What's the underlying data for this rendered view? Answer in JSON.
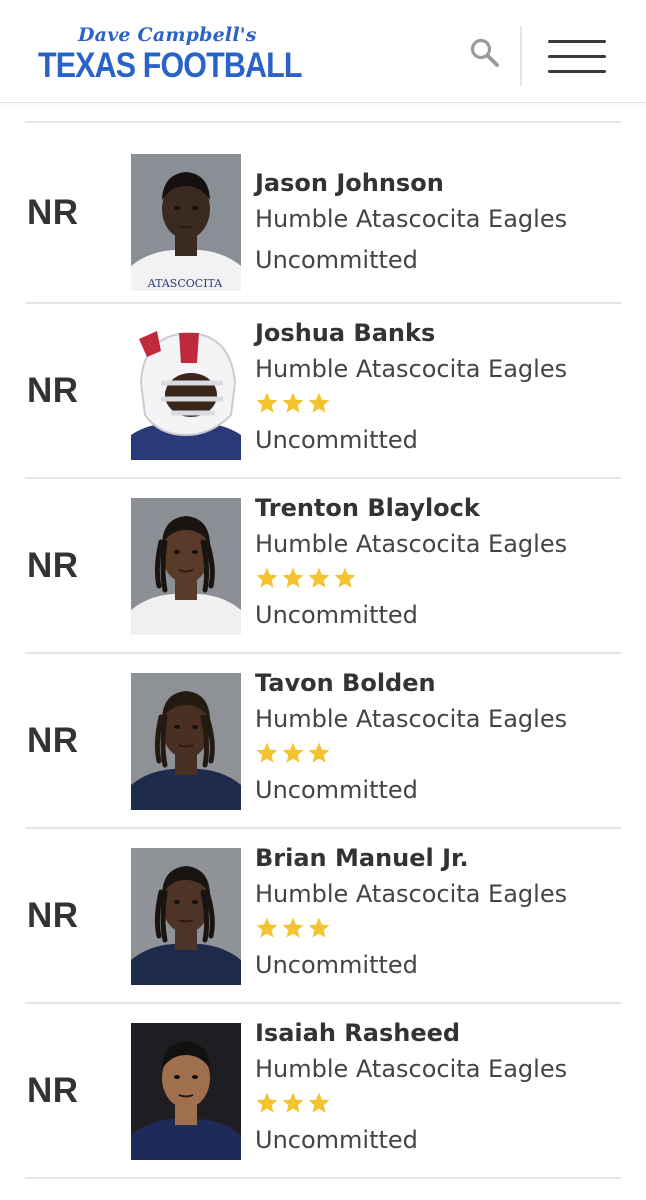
{
  "header": {
    "logo_script": "Dave Campbell's",
    "logo_main": "TEXAS FOOTBALL",
    "accent_color": "#2a63c8"
  },
  "players": [
    {
      "rank": "NR",
      "name": "Jason Johnson",
      "school": "Humble Atascocita Eagles",
      "stars": 0,
      "status": "Uncommitted",
      "photo_caption": "ATASCOCITA"
    },
    {
      "rank": "NR",
      "name": "Joshua Banks",
      "school": "Humble Atascocita Eagles",
      "stars": 3,
      "status": "Uncommitted"
    },
    {
      "rank": "NR",
      "name": "Trenton Blaylock",
      "school": "Humble Atascocita Eagles",
      "stars": 4,
      "status": "Uncommitted"
    },
    {
      "rank": "NR",
      "name": "Tavon Bolden",
      "school": "Humble Atascocita Eagles",
      "stars": 3,
      "status": "Uncommitted"
    },
    {
      "rank": "NR",
      "name": "Brian Manuel Jr.",
      "school": "Humble Atascocita Eagles",
      "stars": 3,
      "status": "Uncommitted"
    },
    {
      "rank": "NR",
      "name": "Isaiah Rasheed",
      "school": "Humble Atascocita Eagles",
      "stars": 3,
      "status": "Uncommitted"
    }
  ],
  "colors": {
    "star": "#f4c430",
    "text": "#333333",
    "divider": "#e5e5e5"
  },
  "icons": {
    "search": "search-icon",
    "menu": "hamburger-menu-icon",
    "star": "star-icon"
  }
}
